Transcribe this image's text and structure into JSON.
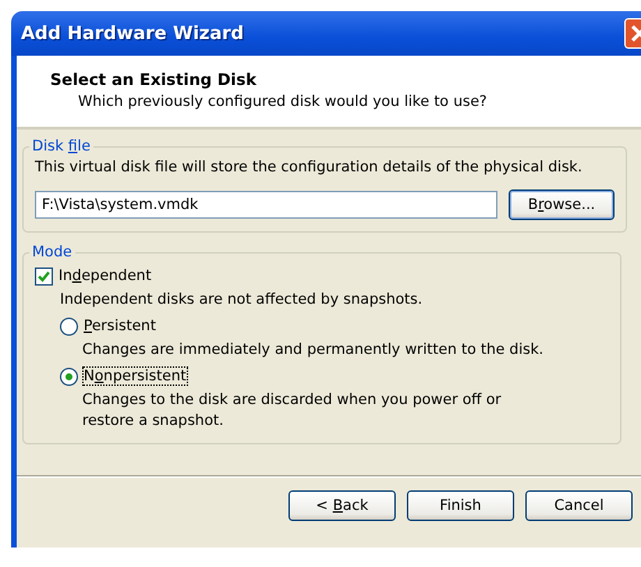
{
  "window": {
    "title": "Add Hardware Wizard"
  },
  "header": {
    "title": "Select an Existing Disk",
    "subtitle": "Which previously configured disk would you like to use?"
  },
  "disk_file": {
    "legend": {
      "before": "Disk ",
      "key": "f",
      "after": "ile"
    },
    "description": "This virtual disk file will store the configuration details of the physical disk.",
    "value": "F:\\Vista\\system.vmdk",
    "browse": {
      "before": "B",
      "key": "r",
      "after": "owse..."
    }
  },
  "mode": {
    "legend": "Mode",
    "independent": {
      "label": {
        "before": "In",
        "key": "d",
        "after": "ependent"
      },
      "checked": true,
      "description": "Independent disks are not affected by snapshots."
    },
    "options": [
      {
        "label": {
          "key": "P",
          "after": "ersistent"
        },
        "selected": false,
        "description": "Changes are immediately and permanently written to the disk."
      },
      {
        "label": {
          "before": "N",
          "key": "o",
          "after": "npersistent"
        },
        "selected": true,
        "description": "Changes to the disk are discarded when you power off or restore a snapshot."
      }
    ]
  },
  "buttons": [
    {
      "before": "< ",
      "key": "B",
      "after": "ack"
    },
    {
      "before": "Finish"
    },
    {
      "before": "Cancel"
    }
  ]
}
